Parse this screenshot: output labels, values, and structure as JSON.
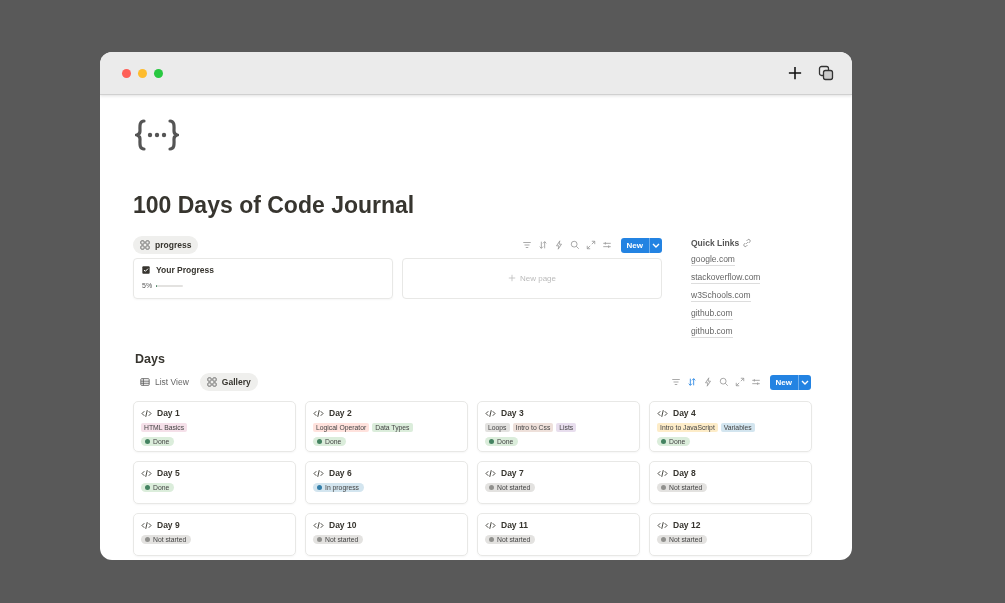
{
  "page": {
    "title": "100 Days of Code Journal"
  },
  "progress_section": {
    "views": [
      {
        "label": "progress",
        "selected": true
      }
    ],
    "toolbar": {
      "sort_active": false,
      "new_label": "New"
    },
    "cards": [
      {
        "title": "Your Progress",
        "reading": "5%",
        "level": 0.05
      }
    ],
    "new_page": "New page"
  },
  "quick_links": {
    "title": "Quick Links",
    "links": [
      "google.com",
      "stackoverflow.com",
      "w3Schools.com",
      "github.com",
      "github.com"
    ]
  },
  "days": {
    "title": "Days",
    "views": [
      {
        "label": "List View",
        "kind": "list",
        "selected": false
      },
      {
        "label": "Gallery",
        "kind": "gallery",
        "selected": true
      }
    ],
    "toolbar": {
      "sort_active": true,
      "new_label": "New"
    },
    "cards": [
      {
        "title": "Day 1",
        "tags": [
          {
            "label": "HTML Basics",
            "color": "#f5e0e9"
          }
        ],
        "status": {
          "label": "Done",
          "color": "#448361"
        }
      },
      {
        "title": "Day 2",
        "tags": [
          {
            "label": "Logical Operator",
            "color": "#ffe2dd"
          },
          {
            "label": "Data Types",
            "color": "#dbeddb"
          }
        ],
        "status": {
          "label": "Done",
          "color": "#448361"
        }
      },
      {
        "title": "Day 3",
        "tags": [
          {
            "label": "Loops",
            "color": "#e3e2e0"
          },
          {
            "label": "Intro to Css",
            "color": "#eee0da"
          },
          {
            "label": "Lists",
            "color": "#e8deee"
          }
        ],
        "status": {
          "label": "Done",
          "color": "#448361"
        }
      },
      {
        "title": "Day 4",
        "tags": [
          {
            "label": "Intro to JavaScript",
            "color": "#fdecc8"
          },
          {
            "label": "Variables",
            "color": "#d3e5ef"
          }
        ],
        "status": {
          "label": "Done",
          "color": "#448361"
        }
      },
      {
        "title": "Day 5",
        "status": {
          "label": "Done",
          "color": "#448361"
        }
      },
      {
        "title": "Day 6",
        "status": {
          "label": "In progress",
          "color": "#337ea9"
        }
      },
      {
        "title": "Day 7",
        "status": {
          "label": "Not started",
          "color": "#91918e"
        }
      },
      {
        "title": "Day 8",
        "status": {
          "label": "Not started",
          "color": "#91918e"
        }
      },
      {
        "title": "Day 9",
        "status": {
          "label": "Not started",
          "color": "#91918e"
        }
      },
      {
        "title": "Day 10",
        "status": {
          "label": "Not started",
          "color": "#91918e"
        }
      },
      {
        "title": "Day 11",
        "status": {
          "label": "Not started",
          "color": "#91918e"
        }
      },
      {
        "title": "Day 12",
        "status": {
          "label": "Not started",
          "color": "#91918e"
        }
      }
    ]
  }
}
